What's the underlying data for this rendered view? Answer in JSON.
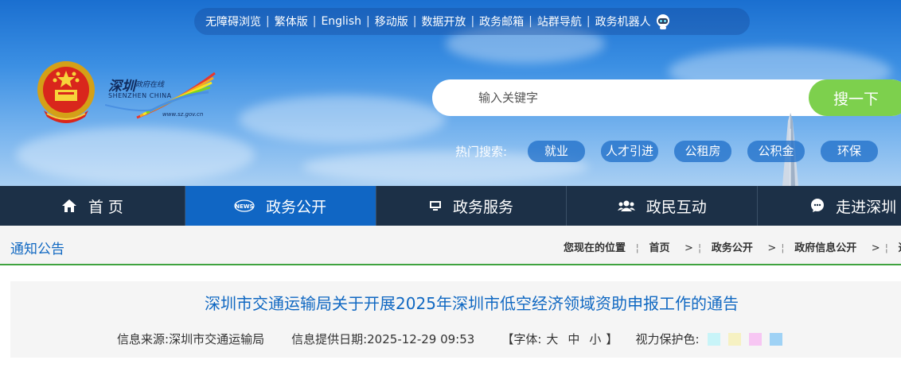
{
  "toplinks": [
    "无障碍浏览",
    "繁体版",
    "English",
    "移动版",
    "数据开放",
    "政务邮箱",
    "站群导航",
    "政务机器人"
  ],
  "logo": {
    "cn_name": "深圳",
    "cn_sub": "政府在线",
    "en_name": "SHENZHEN CHINA",
    "url": "www.sz.gov.cn"
  },
  "search": {
    "placeholder": "输入关键字",
    "button": "搜一下"
  },
  "hot_search": {
    "label": "热门搜索:",
    "items": [
      "就业",
      "人才引进",
      "公租房",
      "公积金",
      "环保"
    ]
  },
  "nav": [
    {
      "label": "首 页",
      "icon": "home-icon",
      "active": false
    },
    {
      "label": "政务公开",
      "icon": "news-icon",
      "active": true
    },
    {
      "label": "政务服务",
      "icon": "monitor-icon",
      "active": false
    },
    {
      "label": "政民互动",
      "icon": "users-icon",
      "active": false
    },
    {
      "label": "走进深圳",
      "icon": "chat-icon",
      "active": false
    }
  ],
  "breadcrumb": {
    "section": "通知公告",
    "label": "您现在的位置",
    "items": [
      "首页",
      "政务公开",
      "政府信息公开",
      "通知"
    ]
  },
  "article": {
    "title": "深圳市交通运输局关于开展2025年深圳市低空经济领域资助申报工作的通告",
    "source_label": "信息来源:",
    "source": "深圳市交通运输局",
    "date_label": "信息提供日期:",
    "date": "2025-12-29 09:53",
    "font_open": "【字体:",
    "font_large": "大",
    "font_medium": "中",
    "font_small": "小",
    "font_close": "】",
    "eye_label": "视力保护色:",
    "eye_colors": [
      "#c8f4f8",
      "#f6f1c2",
      "#f7c6f3",
      "#9fd2f5"
    ]
  },
  "colors": {
    "nav_bg": "#1c3047",
    "nav_active": "#1066c4",
    "search_button": "#7dd04d",
    "title_blue": "#1068c2"
  }
}
